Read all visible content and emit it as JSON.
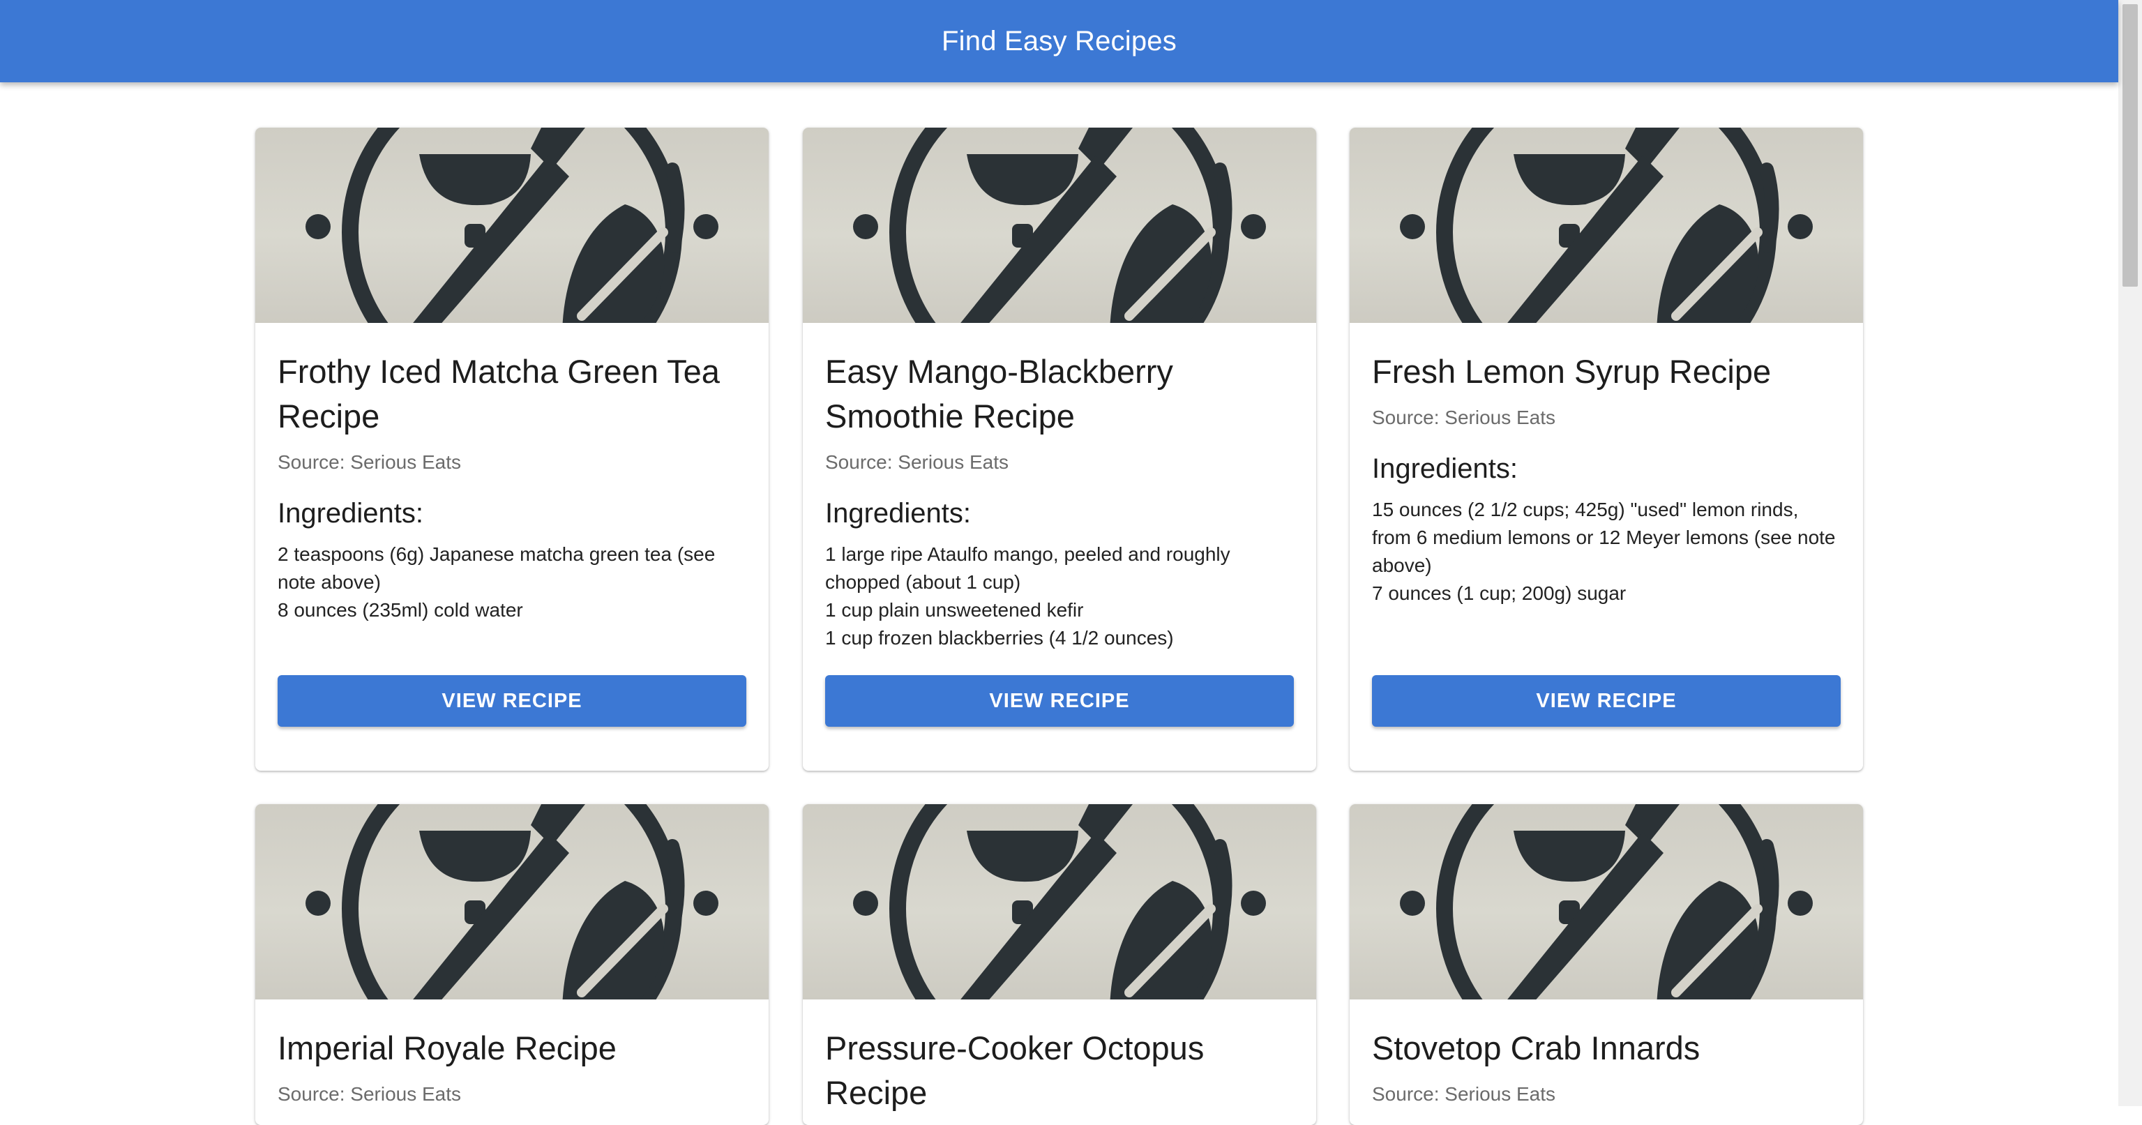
{
  "header": {
    "title": "Find Easy Recipes"
  },
  "card_common": {
    "ingredients_heading": "Ingredients:",
    "button_label": "VIEW RECIPE",
    "image_icon": "bowl-spoon-leaf-logo-icon"
  },
  "recipes": [
    {
      "title": "Frothy Iced Matcha Green Tea Recipe",
      "source": "Source: Serious Eats",
      "ingredients": [
        "2 teaspoons (6g) Japanese matcha green tea (see note above)",
        "8 ounces (235ml) cold water"
      ]
    },
    {
      "title": "Easy Mango-Blackberry Smoothie Recipe",
      "source": "Source: Serious Eats",
      "ingredients": [
        "1 large ripe Ataulfo mango, peeled and roughly chopped (about 1 cup)",
        "1 cup plain unsweetened kefir",
        "1 cup frozen blackberries (4 1/2 ounces)"
      ]
    },
    {
      "title": "Fresh Lemon Syrup Recipe",
      "source": "Source: Serious Eats",
      "ingredients": [
        "15 ounces (2 1/2 cups; 425g) \"used\" lemon rinds, from 6 medium lemons or 12 Meyer lemons (see note above)",
        "7 ounces (1 cup; 200g) sugar"
      ]
    },
    {
      "title": "Imperial Royale Recipe",
      "source": "Source: Serious Eats",
      "ingredients": []
    },
    {
      "title": "Pressure-Cooker Octopus Recipe",
      "source": "",
      "ingredients": []
    },
    {
      "title": "Stovetop Crab Innards",
      "source": "Source: Serious Eats",
      "ingredients": []
    }
  ],
  "colors": {
    "primary": "#3c78d4",
    "background": "#ffffff",
    "secondary_text": "#6b6b6b"
  }
}
